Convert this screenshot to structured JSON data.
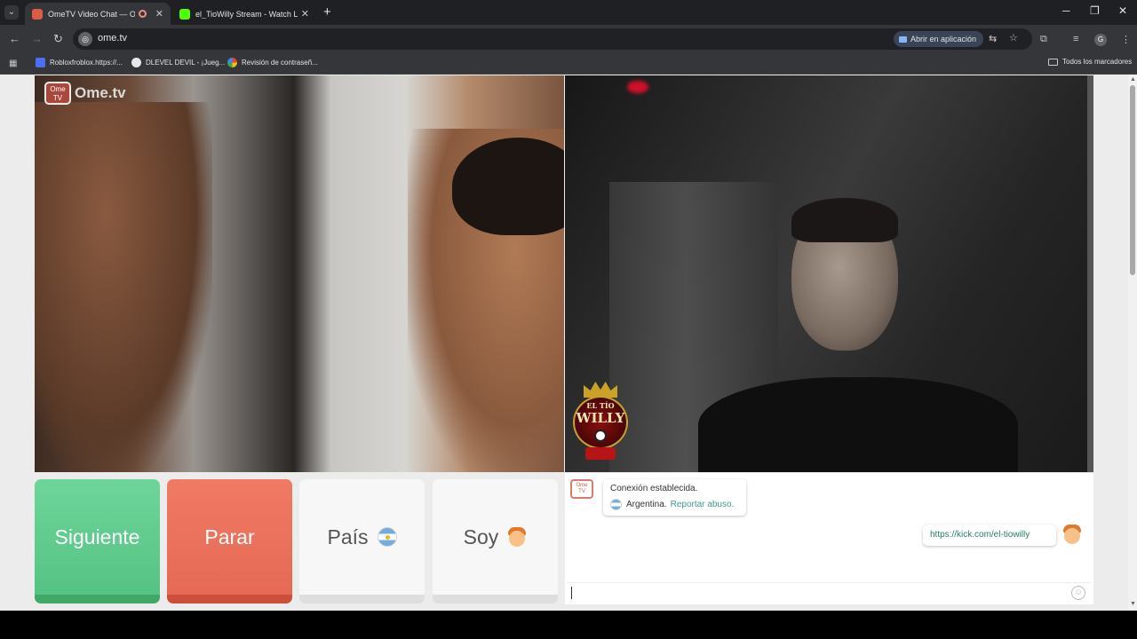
{
  "browser": {
    "tabs": [
      {
        "title": "OmeTV Video Chat — Omegl",
        "active": true
      },
      {
        "title": "el_TioWilly Stream - Watch Live on",
        "active": false
      }
    ],
    "url": "ome.tv",
    "open_app_label": "Abrir en aplicación",
    "profile_initial": "G",
    "bookmarks": [
      {
        "label": "Robloxfroblox.https://..."
      },
      {
        "label": "DLEVEL DEVIL - ¡Jueg..."
      },
      {
        "label": "Revisión de contraseñ..."
      }
    ],
    "all_bookmarks_label": "Todos los marcadores"
  },
  "ometv": {
    "logo_box": "Ome TV",
    "logo_text": "Ome.tv",
    "stream_badge": {
      "line1": "EL TÍO",
      "line2": "WILLY"
    },
    "buttons": {
      "next": "Siguiente",
      "stop": "Parar",
      "country": "País",
      "gender": "Soy"
    },
    "chat": {
      "system_line1": "Conexión establecida.",
      "system_country": "Argentina.",
      "report_link": "Reportar abuso.",
      "my_message": "https://kick.com/el-tiowilly"
    }
  },
  "colors": {
    "next_green": "#5ccb8a",
    "stop_red": "#e96f59",
    "link_teal": "#3a9c8e"
  }
}
